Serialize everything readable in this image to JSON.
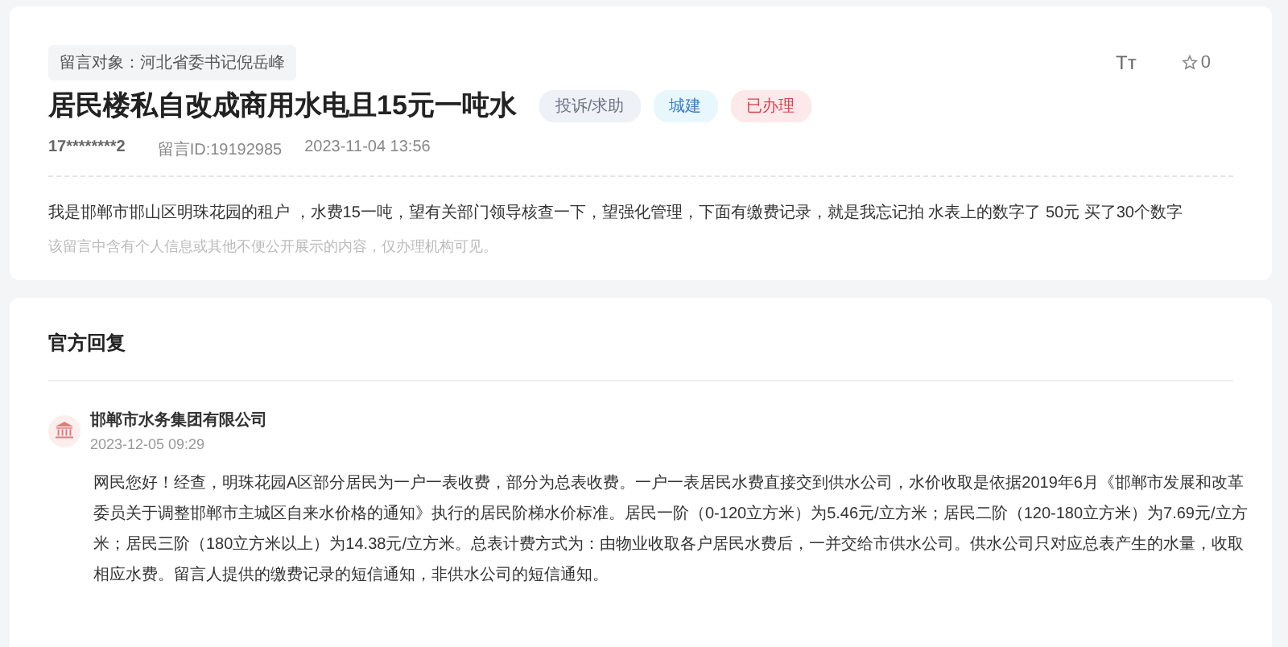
{
  "message": {
    "target": "留言对象：河北省委书记倪岳峰",
    "title": "居民楼私自改成商用水电且15元一吨水",
    "font_size_button": "Tт",
    "favorite_count": "0",
    "tags": [
      {
        "label": "投诉/求助",
        "color": "#eef1f6"
      },
      {
        "label": "城建",
        "color": "#e8f7fb"
      },
      {
        "label": "已办理",
        "color": "#fde8ea"
      }
    ],
    "author": "17********2",
    "id": "留言ID:19192985",
    "time": "2023-11-04 13:56",
    "body": "我是邯郸市邯山区明珠花园的租户 ，水费15一吨，望有关部门领导核查一下，望强化管理，下面有缴费记录，就是我忘记拍 水表上的数字了 50元 买了30个数字",
    "notice": "该留言中含有个人信息或其他不便公开展示的内容，仅办理机构可见。"
  },
  "reply": {
    "heading": "官方回复",
    "org": "邯郸市水务集团有限公司",
    "time": "2023-12-05 09:29",
    "body": "网民您好！经查，明珠花园A区部分居民为一户一表收费，部分为总表收费。一户一表居民水费直接交到供水公司，水价收取是依据2019年6月《邯郸市发展和改革委员关于调整邯郸市主城区自来水价格的通知》执行的居民阶梯水价标准。居民一阶（0-120立方米）为5.46元/立方米；居民二阶（120-180立方米）为7.69元/立方米；居民三阶（180立方米以上）为14.38元/立方米。总表计费方式为：由物业收取各户居民水费后，一并交给市供水公司。供水公司只对应总表产生的水量，收取相应水费。留言人提供的缴费记录的短信通知，非供水公司的短信通知。"
  }
}
